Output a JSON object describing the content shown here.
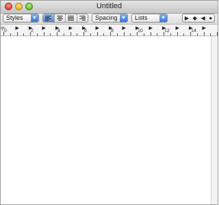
{
  "window": {
    "title": "Untitled"
  },
  "toolbar": {
    "styles_label": "Styles",
    "spacing_label": "Spacing",
    "lists_label": "Lists",
    "popup_arrow": "▼",
    "alignment": {
      "options": [
        "align-left",
        "align-center",
        "justify",
        "align-right"
      ],
      "selected": "align-left"
    },
    "tab_glyphs": [
      "▶",
      "◆",
      "◀",
      "●"
    ]
  },
  "ruler": {
    "numbers": [
      "0",
      "2",
      "4",
      "6",
      "8",
      "10",
      "12",
      "14"
    ],
    "tab_glyph": "▶",
    "margin_glyph": "╤"
  }
}
